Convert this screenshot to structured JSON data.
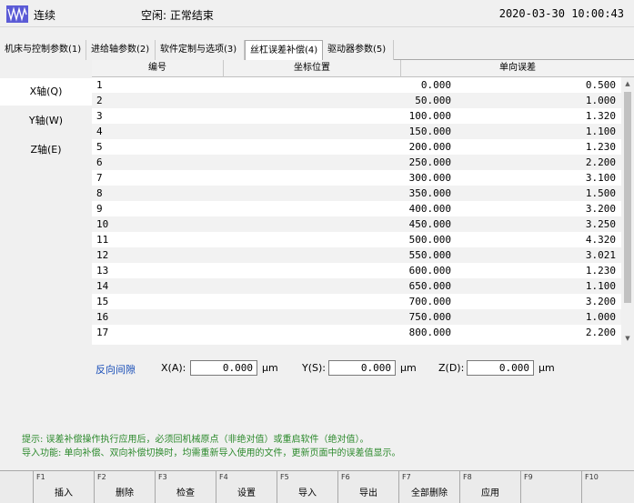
{
  "header": {
    "mode": "连续",
    "status": "空闲: 正常结束",
    "datetime": "2020-03-30 10:00:43",
    "logo_icon": "wave-icon",
    "logo_color": "#5b5bd6"
  },
  "tabs": [
    {
      "label": "机床与控制参数(1)"
    },
    {
      "label": "进给轴参数(2)"
    },
    {
      "label": "软件定制与选项(3)"
    },
    {
      "label": "丝杠误差补偿(4)",
      "active": true
    },
    {
      "label": "驱动器参数(5)"
    }
  ],
  "axes": [
    {
      "label": "X轴(Q)",
      "active": true
    },
    {
      "label": "Y轴(W)"
    },
    {
      "label": "Z轴(E)"
    }
  ],
  "table": {
    "headers": [
      "编号",
      "坐标位置",
      "单向误差"
    ],
    "rows": [
      [
        "1",
        "0.000",
        "0.500"
      ],
      [
        "2",
        "50.000",
        "1.000"
      ],
      [
        "3",
        "100.000",
        "1.320"
      ],
      [
        "4",
        "150.000",
        "1.100"
      ],
      [
        "5",
        "200.000",
        "1.230"
      ],
      [
        "6",
        "250.000",
        "2.200"
      ],
      [
        "7",
        "300.000",
        "3.100"
      ],
      [
        "8",
        "350.000",
        "1.500"
      ],
      [
        "9",
        "400.000",
        "3.200"
      ],
      [
        "10",
        "450.000",
        "3.250"
      ],
      [
        "11",
        "500.000",
        "4.320"
      ],
      [
        "12",
        "550.000",
        "3.021"
      ],
      [
        "13",
        "600.000",
        "1.230"
      ],
      [
        "14",
        "650.000",
        "1.100"
      ],
      [
        "15",
        "700.000",
        "3.200"
      ],
      [
        "16",
        "750.000",
        "1.000"
      ],
      [
        "17",
        "800.000",
        "2.200"
      ]
    ]
  },
  "backlash": {
    "label": "反向间隙",
    "x_label": "X(A):",
    "x_value": "0.000",
    "y_label": "Y(S):",
    "y_value": "0.000",
    "z_label": "Z(D):",
    "z_value": "0.000",
    "unit": "μm"
  },
  "hints": {
    "line1": "提示: 误差补偿操作执行应用后，必须回机械原点（非绝对值）或重启软件（绝对值）。",
    "line2": "导入功能: 单向补偿、双向补偿切换时，均需重新导入使用的文件，更新页面中的误差值显示。",
    "color": "#2d8a2d"
  },
  "fkeys": [
    {
      "key": "F1",
      "label": "插入"
    },
    {
      "key": "F2",
      "label": "删除"
    },
    {
      "key": "F3",
      "label": "检查"
    },
    {
      "key": "F4",
      "label": "设置"
    },
    {
      "key": "F5",
      "label": "导入"
    },
    {
      "key": "F6",
      "label": "导出"
    },
    {
      "key": "F7",
      "label": "全部删除"
    },
    {
      "key": "F8",
      "label": "应用"
    },
    {
      "key": "F9",
      "label": ""
    },
    {
      "key": "F10",
      "label": ""
    }
  ]
}
